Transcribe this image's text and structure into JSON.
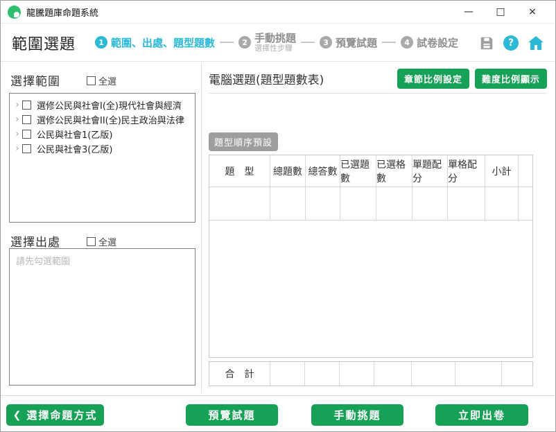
{
  "window": {
    "title": "龍騰題庫命題系統",
    "minimize": "—",
    "maximize": "□",
    "close": "×"
  },
  "nav": {
    "page_title": "範圍選題",
    "steps": [
      {
        "num": "1",
        "label": "範圍、出處、題型題數",
        "sub": ""
      },
      {
        "num": "2",
        "label": "手動挑題",
        "sub": "選擇性步驟"
      },
      {
        "num": "3",
        "label": "預覽試題",
        "sub": ""
      },
      {
        "num": "4",
        "label": "試卷設定",
        "sub": ""
      }
    ],
    "icons": {
      "save": "save-icon",
      "help": "?",
      "home": "home-icon"
    }
  },
  "range_panel": {
    "title": "選擇範圍",
    "select_all": "全選",
    "items": [
      "選修公民與社會I(全)現代社會與經濟",
      "選修公民與社會II(全)民主政治與法律",
      "公民與社會1(乙版)",
      "公民與社會3(乙版)"
    ]
  },
  "source_panel": {
    "title": "選擇出處",
    "select_all": "全選",
    "placeholder": "請先勾選範圍"
  },
  "main_panel": {
    "title": "電腦選題(題型題數表)",
    "chapter_ratio_btn": "章節比例設定",
    "difficulty_ratio_btn": "難度比例顯示",
    "order_tag": "題型順序預設",
    "table_headers": [
      "題　型",
      "總題數",
      "總答數",
      "已選題數",
      "已選格數",
      "單題配分",
      "單格配分",
      "小計",
      ""
    ],
    "totals_label": "合　計"
  },
  "footer": {
    "back_icon": "❮",
    "back": "選擇命題方式",
    "preview": "預覽試題",
    "manual": "手動挑題",
    "generate": "立即出卷"
  },
  "colors": {
    "green": "#17a157",
    "cyan": "#2cb9d8",
    "gray_tag": "#9e9e9e"
  }
}
